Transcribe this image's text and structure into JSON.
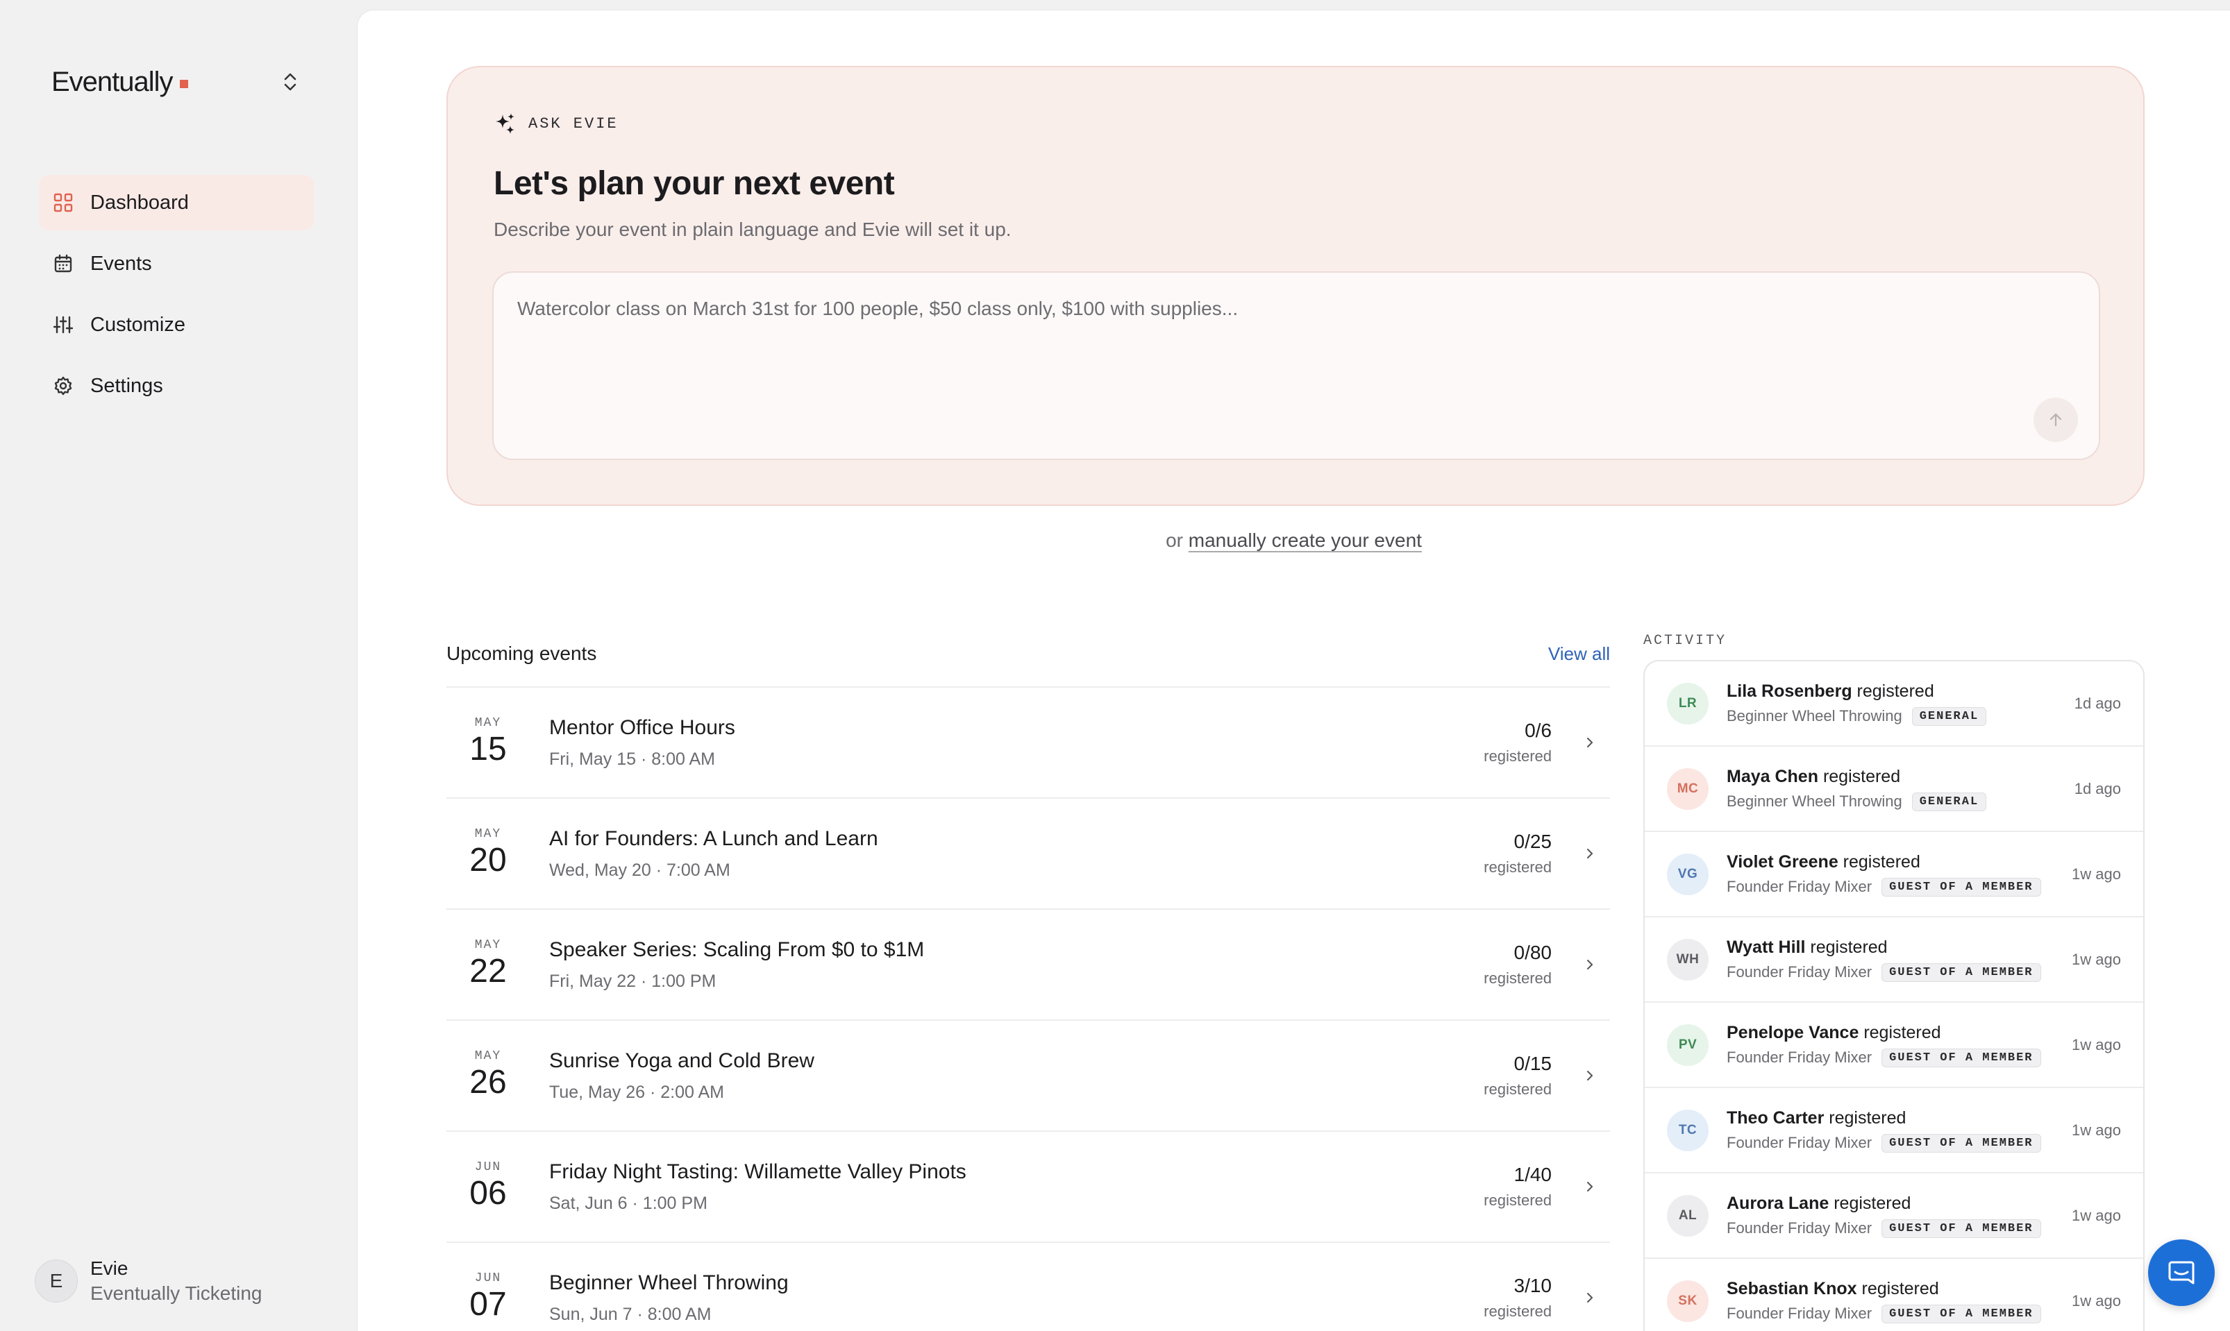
{
  "brand": {
    "name": "Eventually"
  },
  "nav": [
    {
      "label": "Dashboard",
      "icon": "grid-icon",
      "active": true
    },
    {
      "label": "Events",
      "icon": "calendar-icon",
      "active": false
    },
    {
      "label": "Customize",
      "icon": "sliders-icon",
      "active": false
    },
    {
      "label": "Settings",
      "icon": "gear-icon",
      "active": false
    }
  ],
  "user": {
    "initial": "E",
    "name": "Evie",
    "org": "Eventually Ticketing"
  },
  "ask": {
    "label": "ASK EVIE",
    "title": "Let's plan your next event",
    "description": "Describe your event in plain language and Evie will set it up.",
    "placeholder": "Watercolor class on March 31st for 100 people, $50 class only, $100 with supplies..."
  },
  "manual": {
    "prefix": "or",
    "link": "manually create your event"
  },
  "events": {
    "title": "Upcoming events",
    "view_all": "View all",
    "items": [
      {
        "month": "MAY",
        "day": "15",
        "name": "Mentor Office Hours",
        "when": "Fri, May 15 · 8:00 AM",
        "count": "0/6",
        "reg": "registered"
      },
      {
        "month": "MAY",
        "day": "20",
        "name": "AI for Founders: A Lunch and Learn",
        "when": "Wed, May 20 · 7:00 AM",
        "count": "0/25",
        "reg": "registered"
      },
      {
        "month": "MAY",
        "day": "22",
        "name": "Speaker Series: Scaling From $0 to $1M",
        "when": "Fri, May 22 · 1:00 PM",
        "count": "0/80",
        "reg": "registered"
      },
      {
        "month": "MAY",
        "day": "26",
        "name": "Sunrise Yoga and Cold Brew",
        "when": "Tue, May 26 · 2:00 AM",
        "count": "0/15",
        "reg": "registered"
      },
      {
        "month": "JUN",
        "day": "06",
        "name": "Friday Night Tasting: Willamette Valley Pinots",
        "when": "Sat, Jun 6 · 1:00 PM",
        "count": "1/40",
        "reg": "registered"
      },
      {
        "month": "JUN",
        "day": "07",
        "name": "Beginner Wheel Throwing",
        "when": "Sun, Jun 7 · 8:00 AM",
        "count": "3/10",
        "reg": "registered"
      }
    ]
  },
  "activity": {
    "title": "ACTIVITY",
    "items": [
      {
        "initials": "LR",
        "name": "Lila Rosenberg",
        "action": "registered",
        "event": "Beginner Wheel Throwing",
        "tag": "GENERAL",
        "time": "1d ago",
        "bg": "#e6f4ea",
        "fg": "#3e8a55"
      },
      {
        "initials": "MC",
        "name": "Maya Chen",
        "action": "registered",
        "event": "Beginner Wheel Throwing",
        "tag": "GENERAL",
        "time": "1d ago",
        "bg": "#fbe6e2",
        "fg": "#d5705e"
      },
      {
        "initials": "VG",
        "name": "Violet Greene",
        "action": "registered",
        "event": "Founder Friday Mixer",
        "tag": "GUEST OF A MEMBER",
        "time": "1w ago",
        "bg": "#e4eef9",
        "fg": "#4f78b0"
      },
      {
        "initials": "WH",
        "name": "Wyatt Hill",
        "action": "registered",
        "event": "Founder Friday Mixer",
        "tag": "GUEST OF A MEMBER",
        "time": "1w ago",
        "bg": "#ededef",
        "fg": "#5a5a60"
      },
      {
        "initials": "PV",
        "name": "Penelope Vance",
        "action": "registered",
        "event": "Founder Friday Mixer",
        "tag": "GUEST OF A MEMBER",
        "time": "1w ago",
        "bg": "#e6f4ea",
        "fg": "#3e8a55"
      },
      {
        "initials": "TC",
        "name": "Theo Carter",
        "action": "registered",
        "event": "Founder Friday Mixer",
        "tag": "GUEST OF A MEMBER",
        "time": "1w ago",
        "bg": "#e4eef9",
        "fg": "#4f78b0"
      },
      {
        "initials": "AL",
        "name": "Aurora Lane",
        "action": "registered",
        "event": "Founder Friday Mixer",
        "tag": "GUEST OF A MEMBER",
        "time": "1w ago",
        "bg": "#ededef",
        "fg": "#5a5a60"
      },
      {
        "initials": "SK",
        "name": "Sebastian Knox",
        "action": "registered",
        "event": "Founder Friday Mixer",
        "tag": "GUEST OF A MEMBER",
        "time": "1w ago",
        "bg": "#fbe6e2",
        "fg": "#d5705e"
      }
    ]
  },
  "colors": {
    "accent": "#e0624f",
    "link": "#2e62b8",
    "chat": "#1d6fd8"
  }
}
